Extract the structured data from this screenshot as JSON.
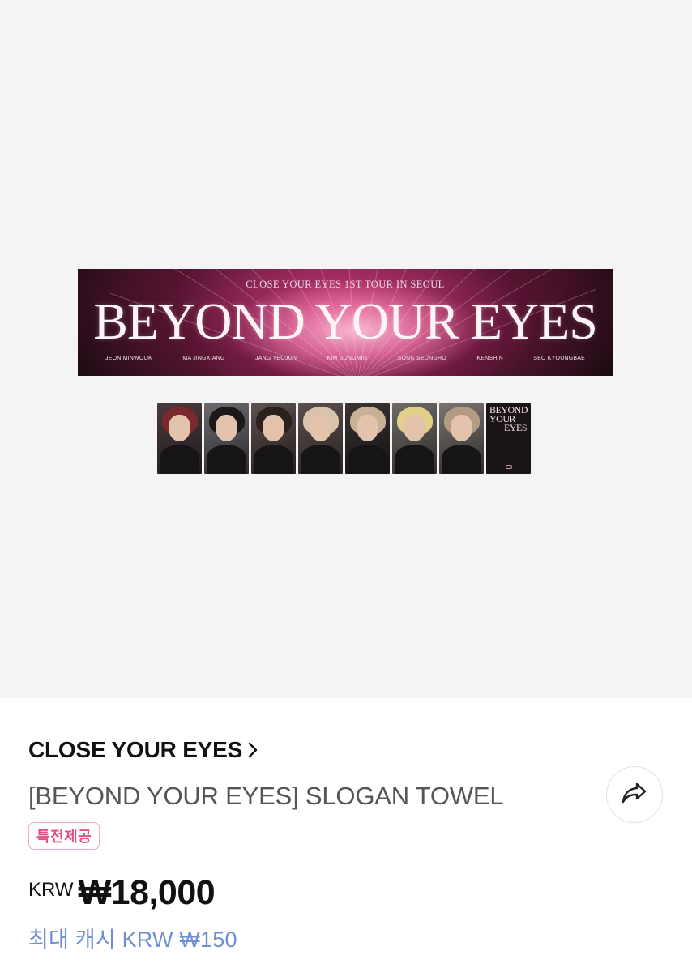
{
  "product_image": {
    "towel": {
      "subtitle": "CLOSE YOUR EYES 1ST TOUR IN SEOUL",
      "title": "BEYOND YOUR EYES",
      "members": [
        "JEON MINWOOK",
        "MA JINGXIANG",
        "JANG YEOJUN",
        "KIM SUNGMIN",
        "SONG SEUNGHO",
        "KENSHIN",
        "SEO KYOUNGBAE"
      ]
    },
    "photocards": [
      {
        "hair": "#7a2a2c"
      },
      {
        "hair": "#1c1719"
      },
      {
        "hair": "#2a201c"
      },
      {
        "hair": "#d9c3ab"
      },
      {
        "hair": "#c8b196"
      },
      {
        "hair": "#e2cf8a"
      },
      {
        "hair": "#b39a83"
      }
    ],
    "cover_card": {
      "line1": "BEYOND",
      "line2": "YOUR",
      "line3": "EYES"
    }
  },
  "product": {
    "brand": "CLOSE YOUR EYES",
    "name": "[BEYOND YOUR EYES] SLOGAN TOWEL",
    "tag": "특전제공",
    "currency": "KRW",
    "price": "₩18,000",
    "cash_reward": "최대 캐시 KRW ₩150"
  },
  "icons": {
    "brand_chevron": "chevron-right-icon",
    "share": "share-arrow-icon"
  },
  "colors": {
    "tag_border": "#f2a9c2",
    "tag_text": "#e64f86",
    "cash_text": "#6f8fd2"
  }
}
